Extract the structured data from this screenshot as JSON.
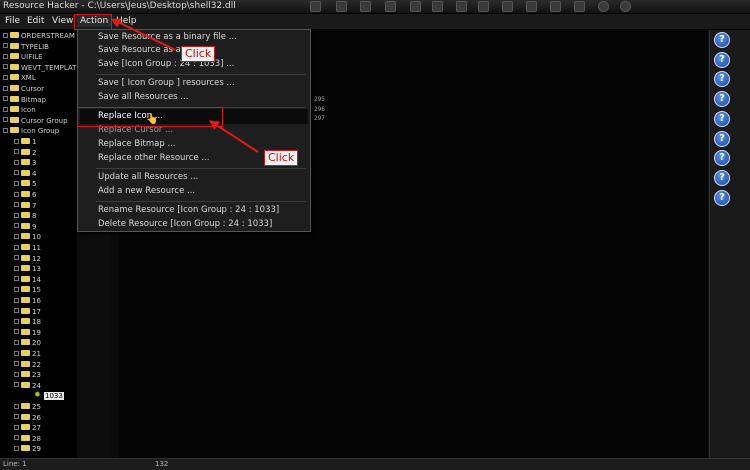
{
  "window": {
    "title": "Resource Hacker  -  C:\\Users\\Jeus\\Desktop\\shell32.dll"
  },
  "menubar": {
    "items": [
      "File",
      "Edit",
      "View",
      "Action",
      "Help"
    ]
  },
  "tree": {
    "top_items": [
      "ORDERSTREAM",
      "TYPELIB",
      "UIFILE",
      "WEVT_TEMPLATE",
      "XML",
      "Cursor",
      "Bitmap",
      "Icon",
      "Cursor Group",
      "Icon Group"
    ],
    "children": [
      "1",
      "2",
      "3",
      "4",
      "5",
      "6",
      "7",
      "8",
      "9",
      "10",
      "11",
      "12",
      "13",
      "14",
      "15",
      "16",
      "17",
      "18",
      "19",
      "20",
      "21",
      "22",
      "23",
      "24"
    ],
    "leaf": "1033",
    "after": [
      "25",
      "26",
      "27",
      "28",
      "29"
    ]
  },
  "editor": {
    "lines": [
      "295",
      "296",
      "297"
    ]
  },
  "action_menu": {
    "items": [
      {
        "label": "Save Resource as a binary file ...",
        "enabled": true
      },
      {
        "label": "Save Resource as a",
        "enabled": true
      },
      {
        "label": "Save [Icon Group : 24 : 1033] ...",
        "enabled": true
      },
      {
        "label": "Save [ Icon Group ] resources ...",
        "enabled": true
      },
      {
        "label": "Save all Resources ...",
        "enabled": true
      },
      {
        "label": "Replace Icon ...",
        "enabled": true
      },
      {
        "label": "Replace Cursor ...",
        "enabled": false
      },
      {
        "label": "Replace Bitmap ...",
        "enabled": true
      },
      {
        "label": "Replace other Resource ...",
        "enabled": true
      },
      {
        "label": "Update all Resources ...",
        "enabled": true
      },
      {
        "label": "Add a new Resource ...",
        "enabled": true
      },
      {
        "label": "Rename Resource [Icon Group : 24 : 1033]",
        "enabled": true
      },
      {
        "label": "Delete Resource [Icon Group : 24 : 1033]",
        "enabled": true
      }
    ]
  },
  "annotations": {
    "callout_1": "Click",
    "callout_2": "Click",
    "accent_color": "#d21818"
  },
  "statusbar": {
    "line": "Line: 1",
    "value": "132"
  },
  "help": {
    "glyph": "?"
  }
}
